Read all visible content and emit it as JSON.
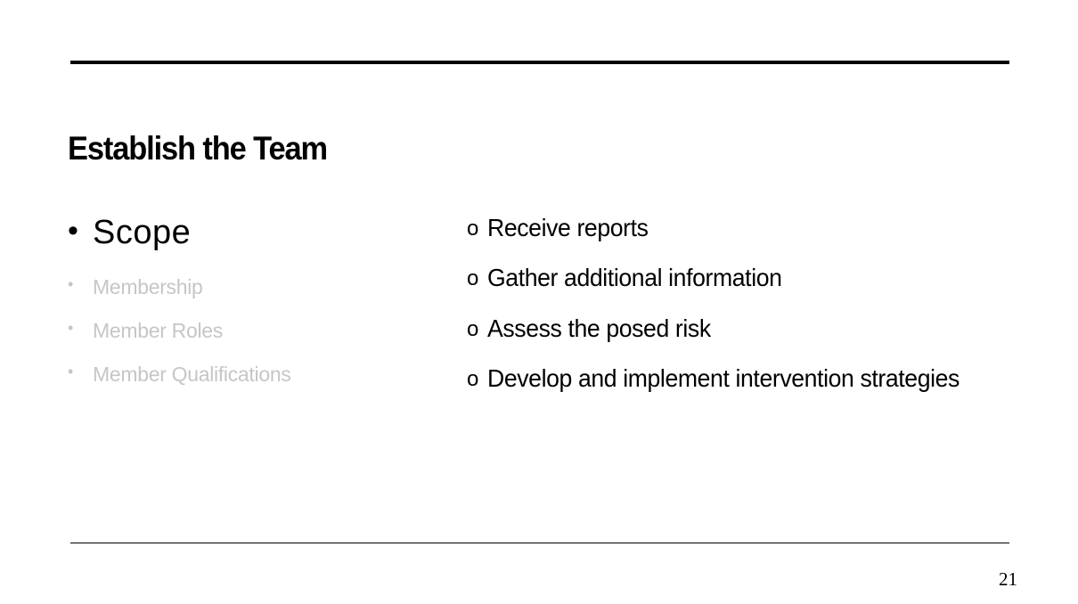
{
  "slide": {
    "title": "Establish the Team",
    "left_items": [
      {
        "bullet": "•",
        "label": "Scope"
      },
      {
        "bullet": "•",
        "label": "Membership"
      },
      {
        "bullet": "•",
        "label": "Member Roles"
      },
      {
        "bullet": "•",
        "label": "Member Qualifications"
      }
    ],
    "right_items": [
      {
        "marker": "o",
        "label": "Receive reports"
      },
      {
        "marker": "o",
        "label": "Gather additional information"
      },
      {
        "marker": "o",
        "label": "Assess the posed risk"
      },
      {
        "marker": "o",
        "label": "Develop and implement intervention strategies"
      }
    ],
    "page_number": "21"
  },
  "colors": {
    "text": "#000000",
    "dimmed_text": "#c6c6c6",
    "background": "#ffffff",
    "rule": "#000000"
  }
}
